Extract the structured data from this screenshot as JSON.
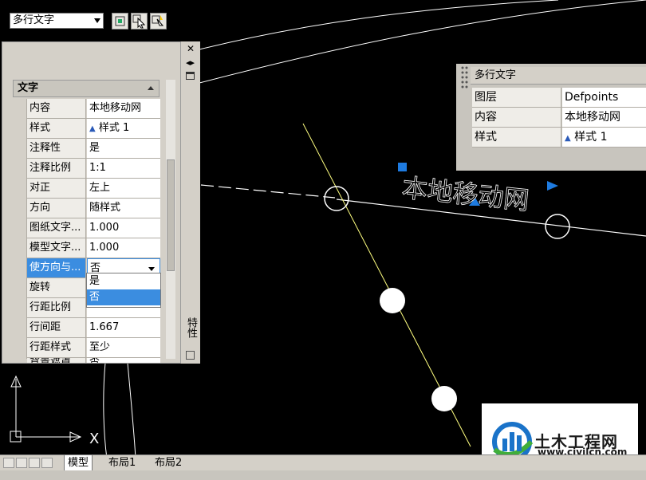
{
  "palette": {
    "object_type": "多行文字",
    "section_title": "文字",
    "side_title": "特性",
    "rows": [
      {
        "key": "内容",
        "value": "本地移动网"
      },
      {
        "key": "样式",
        "value": "样式 1",
        "icon": "text-style-icon"
      },
      {
        "key": "注释性",
        "value": "是"
      },
      {
        "key": "注释比例",
        "value": "1:1"
      },
      {
        "key": "对正",
        "value": "左上"
      },
      {
        "key": "方向",
        "value": "随样式"
      },
      {
        "key": "图纸文字...",
        "value": "1.000"
      },
      {
        "key": "模型文字...",
        "value": "1.000"
      },
      {
        "key": "使方向与...",
        "value": "否",
        "selected": true
      },
      {
        "key": "旋转",
        "value": ""
      },
      {
        "key": "行距比例",
        "value": ""
      },
      {
        "key": "行间距",
        "value": "1.667"
      },
      {
        "key": "行距样式",
        "value": "至少"
      },
      {
        "key": "背景遮罩",
        "value": "否"
      }
    ],
    "dropdown_options": [
      "是",
      "否"
    ],
    "dropdown_highlight": "否"
  },
  "quick_properties": {
    "title": "多行文字",
    "rows": [
      {
        "key": "图层",
        "value": "Defpoints"
      },
      {
        "key": "内容",
        "value": "本地移动网"
      },
      {
        "key": "样式",
        "value": "样式 1"
      }
    ]
  },
  "drawing": {
    "mtext": "本地移动网",
    "ucs_x": "X"
  },
  "tabs": [
    "模型",
    "布局1",
    "布局2"
  ],
  "logo": {
    "name": "土木工程网",
    "url": "www.civilcn.com"
  },
  "colors": {
    "background": "#000000",
    "selection": "#3b8de0",
    "grip": "#1e7be0",
    "annotation_arrow": "#e02020",
    "line_yellow": "#ffff80"
  }
}
